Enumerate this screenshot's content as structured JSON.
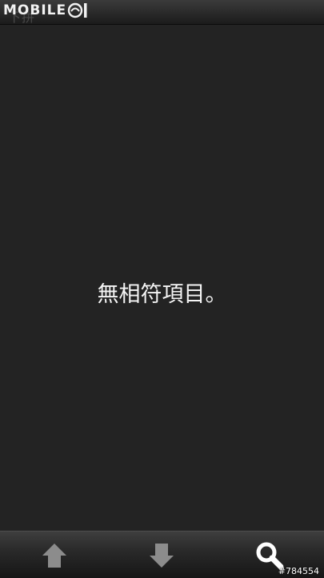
{
  "header": {
    "watermark_text": "MOBILE01",
    "faded_title": "下拼"
  },
  "main": {
    "empty_message": "無相符項目。"
  },
  "toolbar": {
    "buttons": [
      {
        "icon": "arrow-up-icon"
      },
      {
        "icon": "arrow-down-icon"
      },
      {
        "icon": "search-icon"
      }
    ]
  },
  "footer": {
    "image_id": "#784554"
  },
  "colors": {
    "background": "#232323",
    "text": "#f5f5f5",
    "icon": "#8c8c8c",
    "search_icon": "#ffffff"
  }
}
